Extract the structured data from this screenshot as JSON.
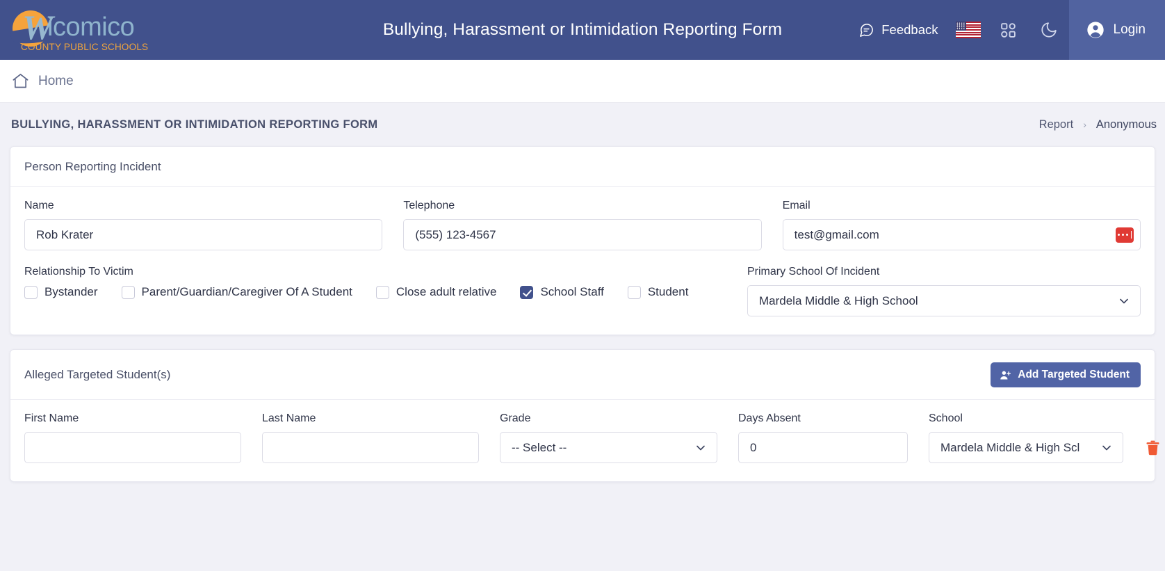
{
  "header": {
    "logo": {
      "initial": "W",
      "word": "icomico",
      "subtitle": "COUNTY PUBLIC SCHOOLS"
    },
    "title": "Bullying, Harassment or Intimidation Reporting Form",
    "feedback_label": "Feedback",
    "language_flag": "us-flag-icon",
    "apps_icon": "apps-grid-icon",
    "theme_icon": "moon-icon",
    "login_label": "Login",
    "bg_color": "#41518c",
    "login_bg_color": "#5163a0"
  },
  "breadcrumb_bar": {
    "home_label": "Home",
    "home_icon": "home-icon"
  },
  "page": {
    "title": "BULLYING, HARASSMENT OR INTIMIDATION REPORTING FORM",
    "breadcrumbs": [
      "Report",
      "Anonymous"
    ],
    "separator": "›"
  },
  "reporter_card": {
    "section_title": "Person Reporting Incident",
    "name": {
      "label": "Name",
      "value": "Rob Krater",
      "placeholder": ""
    },
    "telephone": {
      "label": "Telephone",
      "value": "(555) 123-4567",
      "placeholder": ""
    },
    "email": {
      "label": "Email",
      "value": "test@gmail.com",
      "placeholder": "",
      "badge_icon": "password-dots-icon",
      "badge_color": "#e03a34"
    },
    "relationship": {
      "label": "Relationship To Victim",
      "options": [
        {
          "label": "Bystander",
          "checked": false
        },
        {
          "label": "Parent/Guardian/Caregiver Of A Student",
          "checked": false
        },
        {
          "label": "Close adult relative",
          "checked": false
        },
        {
          "label": "School Staff",
          "checked": true
        },
        {
          "label": "Student",
          "checked": false
        }
      ]
    },
    "primary_school": {
      "label": "Primary School Of Incident",
      "value": "Mardela Middle & High School",
      "chevron_icon": "chevron-down-icon"
    }
  },
  "students_card": {
    "section_title": "Alleged Targeted Student(s)",
    "add_button": {
      "label": "Add Targeted Student",
      "icon": "user-plus-icon",
      "color": "#5164a6"
    },
    "columns": {
      "first_name": "First Name",
      "last_name": "Last Name",
      "grade": "Grade",
      "days_absent": "Days Absent",
      "school": "School"
    },
    "row": {
      "first_name": "",
      "last_name": "",
      "grade": "-- Select --",
      "days_absent": "0",
      "school": "Mardela Middle & High Scl",
      "delete_icon": "trash-icon",
      "delete_color": "#f05a34"
    }
  }
}
